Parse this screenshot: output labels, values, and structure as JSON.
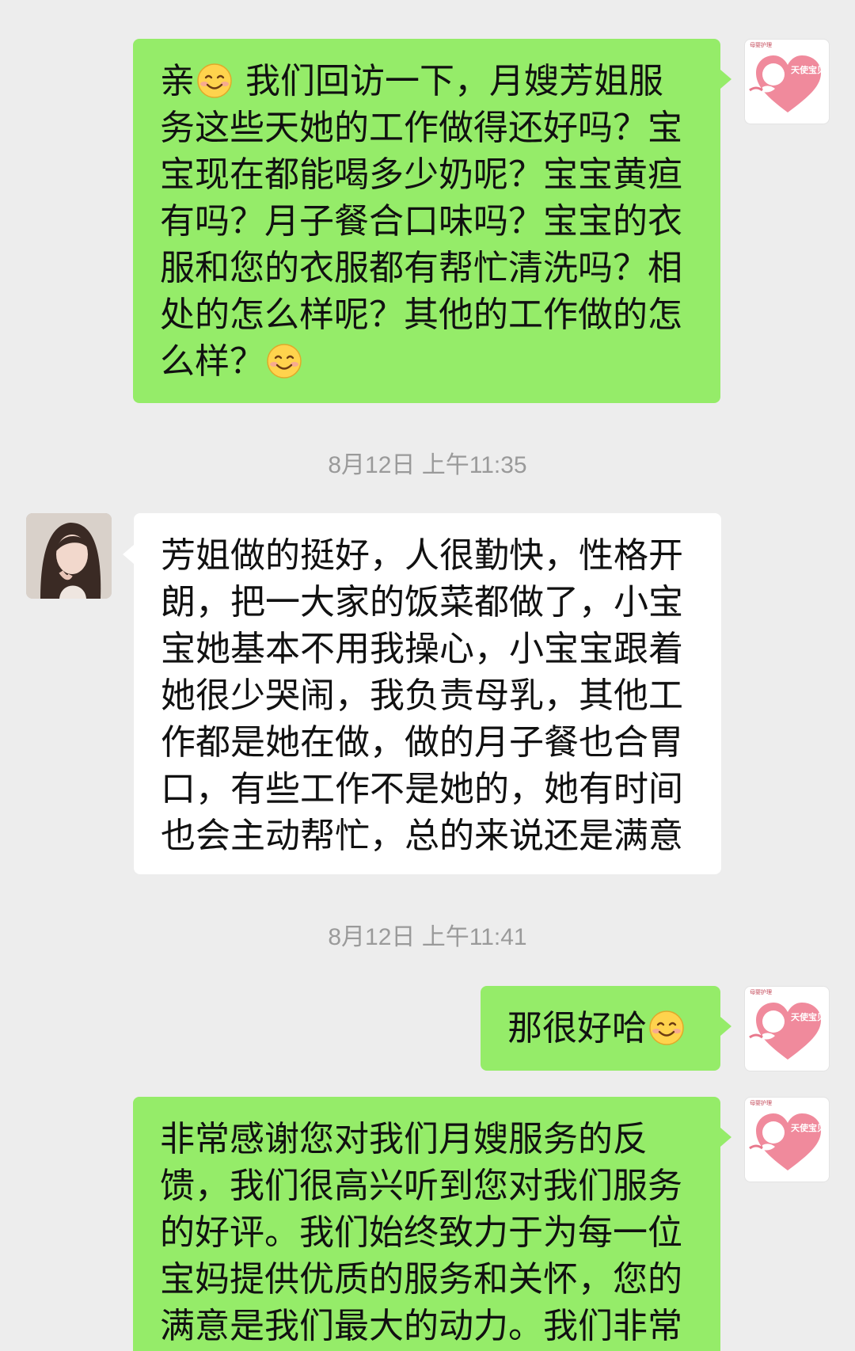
{
  "brand": {
    "tiny_label": "母婴护理",
    "name": "天使宝贝"
  },
  "timestamps": [
    "8月12日 上午11:35",
    "8月12日 上午11:41"
  ],
  "messages": [
    {
      "side": "outgoing",
      "parts": [
        "亲",
        "[emoji:smiling-face]",
        " 我们回访一下，月嫂芳姐服务这些天她的工作做得还好吗？宝宝现在都能喝多少奶呢？宝宝黄疸有吗？月子餐合口味吗？宝宝的衣服和您的衣服都有帮忙清洗吗？相处的怎么样呢？其他的工作做的怎么样？",
        "[emoji:smiling-face]"
      ]
    },
    {
      "side": "incoming",
      "parts": [
        "芳姐做的挺好，人很勤快，性格开朗，把一大家的饭菜都做了，小宝宝她基本不用我操心，小宝宝跟着她很少哭闹，我负责母乳，其他工作都是她在做，做的月子餐也合胃口，有些工作不是她的，她有时间也会主动帮忙，总的来说还是满意"
      ]
    },
    {
      "side": "outgoing",
      "parts": [
        "那很好哈",
        "[emoji:smiling-face]"
      ]
    },
    {
      "side": "outgoing",
      "parts": [
        "非常感谢您对我们月嫂服务的反馈，我们很高兴听到您对我们服务的好评。我们始终致力于为每一位宝妈提供优质的服务和关怀，您的满意是我们最大的动力。我们非常"
      ]
    }
  ],
  "colors": {
    "background": "#ededed",
    "outgoing_bubble": "#95ec69",
    "incoming_bubble": "#ffffff",
    "timestamp": "#9a9a9a"
  },
  "icons": [
    "smiling-face-emoji",
    "brand-heart-logo",
    "user-avatar-photo"
  ]
}
